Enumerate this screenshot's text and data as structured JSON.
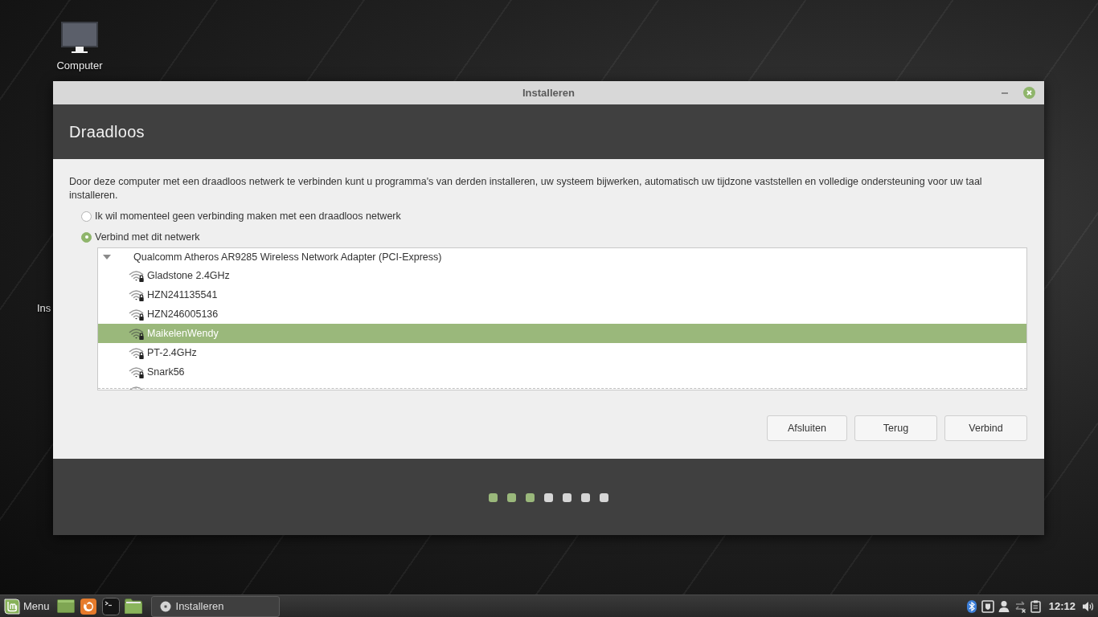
{
  "desktop": {
    "icons": [
      {
        "kind": "computer",
        "label": "Computer"
      },
      {
        "kind": "covered",
        "label": "Ins"
      }
    ]
  },
  "window": {
    "title": "Installeren",
    "heading": "Draadloos",
    "description": "Door deze computer met een draadloos netwerk te verbinden kunt u programma's van derden installeren, uw systeem bijwerken, automatisch uw tijdzone vaststellen en volledige ondersteuning voor uw taal installeren.",
    "options": [
      {
        "label": "Ik wil momenteel geen verbinding maken met een draadloos netwerk",
        "selected": false
      },
      {
        "label": "Verbind met dit netwerk",
        "selected": true
      }
    ],
    "network_tree": [
      {
        "label": "Qualcomm Atheros AR9285 Wireless Network Adapter (PCI-Express)",
        "expanded": true,
        "children": [
          {
            "label": "Gladstone 2.4GHz",
            "selected": false
          },
          {
            "label": "HZN241135541",
            "selected": false
          },
          {
            "label": "HZN246005136",
            "selected": false
          },
          {
            "label": "MaikelenWendy",
            "selected": true
          },
          {
            "label": "PT-2.4GHz",
            "selected": false
          },
          {
            "label": "Snark56",
            "selected": false
          },
          {
            "selected": false
          }
        ]
      }
    ],
    "buttons": [
      "Afsluiten",
      "Terug",
      "Verbind"
    ],
    "steps": [
      {
        "done": true
      },
      {
        "done": true
      },
      {
        "done": true
      },
      {
        "done": false
      },
      {
        "done": false
      },
      {
        "done": false
      },
      {
        "done": false
      }
    ]
  },
  "taskbar": {
    "menu": "Menu",
    "launchers": [
      {
        "kind": "desktop"
      },
      {
        "kind": "browser"
      },
      {
        "kind": "terminal"
      },
      {
        "kind": "folder"
      }
    ],
    "windows": [
      {
        "title": "Installeren"
      }
    ],
    "tray": [
      {
        "kind": "bluetooth"
      },
      {
        "kind": "update"
      },
      {
        "kind": "user"
      },
      {
        "kind": "network"
      },
      {
        "kind": "clipboard"
      },
      {
        "kind": "clock",
        "label": "12:12"
      },
      {
        "kind": "volume"
      }
    ]
  }
}
